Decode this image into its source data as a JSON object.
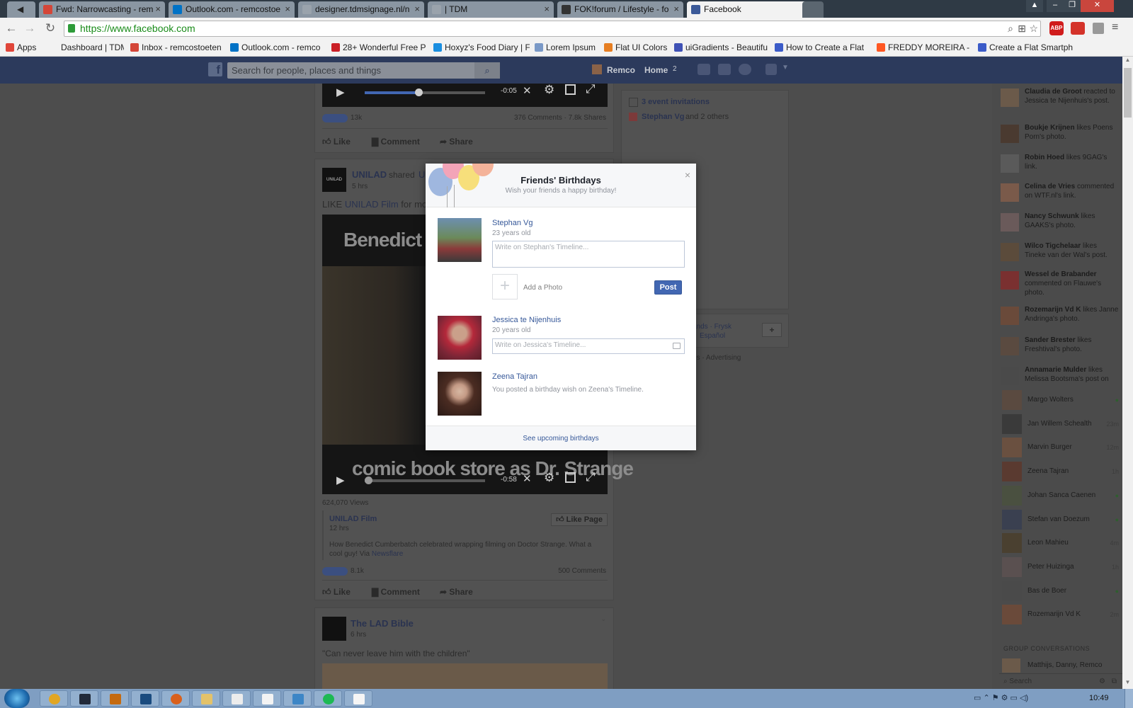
{
  "browser": {
    "tabs": [
      {
        "label": "Fwd: Narrowcasting - rem",
        "favicon_color": "#d44638",
        "icon": "gmail-icon"
      },
      {
        "label": "Outlook.com - remcostoe",
        "favicon_color": "#0072c6",
        "icon": "outlook-icon"
      },
      {
        "label": "designer.tdmsignage.nl/n",
        "favicon_color": "#9aa3ac",
        "icon": "page-icon"
      },
      {
        "label": "| TDM",
        "favicon_color": "#9aa3ac",
        "icon": "page-icon"
      },
      {
        "label": "FOK!forum / Lifestyle - fo",
        "favicon_color": "#333333",
        "icon": "fok-icon"
      },
      {
        "label": "Facebook",
        "favicon_color": "#3b5998",
        "icon": "facebook-icon"
      }
    ],
    "url": "https://www.facebook.com",
    "bookmarks": [
      {
        "label": "Apps",
        "color": "#e0463a"
      },
      {
        "label": "Dashboard | TDM",
        "color": "#f2f2f2"
      },
      {
        "label": "Inbox - remcostoeten",
        "color": "#d44638"
      },
      {
        "label": "Outlook.com - remco",
        "color": "#0072c6"
      },
      {
        "label": "28+ Wonderful Free P",
        "color": "#cb2027"
      },
      {
        "label": "Hoxyz's Food Diary | F",
        "color": "#1a8ee0"
      },
      {
        "label": "Lorem Ipsum",
        "color": "#7a99c7"
      },
      {
        "label": "Flat UI Colors",
        "color": "#e67e22"
      },
      {
        "label": "uiGradients - Beautifu",
        "color": "#3f51b5"
      },
      {
        "label": "How to Create a Flat",
        "color": "#3b5bc8"
      },
      {
        "label": "FREDDY MOREIRA - M",
        "color": "#ff5722"
      },
      {
        "label": "Create a Flat Smartph",
        "color": "#3b5bc8"
      }
    ],
    "ext_badge": "ABP"
  },
  "fb": {
    "search_placeholder": "Search for people, places and things",
    "user_name": "Remco",
    "home_label": "Home",
    "home_count": "2"
  },
  "feed": {
    "post1": {
      "time_left": "-0:05",
      "reactions": "13k",
      "comments_shares": "376 Comments · 7.8k Shares",
      "like": "Like",
      "comment": "Comment",
      "share": "Share"
    },
    "post2": {
      "page": "UNILAD",
      "shared": "shared",
      "shared_target": "UNI",
      "time": "5 hrs",
      "text_prefix": "LIKE",
      "text_link": "UNILAD Film",
      "text_suffix": "for more",
      "video_title_top": "Benedict Cu",
      "video_title_bottom": "comic book store as Dr. Strange",
      "video_time": "-0:58",
      "views": "624,070 Views",
      "source_name": "UNILAD Film",
      "source_time": "12 hrs",
      "like_page": "Like Page",
      "description": "How Benedict Cumberbatch celebrated wrapping filming on Doctor Strange. What a cool guy! Via",
      "description_link": "Newsflare",
      "reactions": "8.1k",
      "comments": "500 Comments",
      "like": "Like",
      "comment": "Comment",
      "share": "Share"
    },
    "post3": {
      "page": "The LAD Bible",
      "time": "6 hrs",
      "text": "\"Can never leave him with the children\""
    }
  },
  "right_col": {
    "invites": "3 event invitations",
    "birthday_name": "Stephan Vg",
    "birthday_rest": "and 2 others",
    "lang_1": "ands · Frysk",
    "lang_2": "Español",
    "footer": "es · Advertising"
  },
  "modal": {
    "title": "Friends' Birthdays",
    "subtitle": "Wish your friends a happy birthday!",
    "close": "×",
    "people": [
      {
        "name": "Stephan Vg",
        "age": "23 years old",
        "placeholder": "Write on Stephan's Timeline..."
      },
      {
        "name": "Jessica te Nijenhuis",
        "age": "20 years old",
        "placeholder": "Write on Jessica's Timeline..."
      },
      {
        "name": "Zeena Tajran",
        "status": "You posted a birthday wish on Zeena's Timeline."
      }
    ],
    "add_photo": "Add a Photo",
    "post": "Post",
    "footer": "See upcoming birthdays"
  },
  "ticker": [
    {
      "name": "Claudia de Groot",
      "text": "reacted to Jessica te Nijenhuis's post."
    },
    {
      "name": "Boukje Krijnen",
      "text": "likes Poens Porn's photo."
    },
    {
      "name": "Robin Hoed",
      "text": "likes 9GAG's link."
    },
    {
      "name": "Celina de Vries",
      "text": "commented on WTF.nl's link."
    },
    {
      "name": "Nancy Schwunk",
      "text": "likes GAAKS's photo."
    },
    {
      "name": "Wilco Tigchelaar",
      "text": "likes Tineke van der Wal's post."
    },
    {
      "name": "Wessel de Brabander",
      "text": "commented on Flauwe's photo."
    },
    {
      "name": "Rozemarijn Vd K",
      "text": "likes Janne Andringa's photo."
    },
    {
      "name": "Sander Brester",
      "text": "likes Freshtival's photo."
    },
    {
      "name": "Annamarie Mulder",
      "text": "likes Melissa Bootsma's post on"
    }
  ],
  "chat_contacts": [
    {
      "name": "Margo Wolters",
      "status": "●"
    },
    {
      "name": "Jan Willem Schealth",
      "status": "23m"
    },
    {
      "name": "Marvin Burger",
      "status": "12m"
    },
    {
      "name": "Zeena Tajran",
      "status": "1h"
    },
    {
      "name": "Johan Sanca Caenen",
      "status": "●"
    },
    {
      "name": "Stefan van Doezum",
      "status": "●"
    },
    {
      "name": "Leon Mahieu",
      "status": "4m"
    },
    {
      "name": "Peter Huizinga",
      "status": "1h"
    },
    {
      "name": "Bas de Boer",
      "status": "●"
    },
    {
      "name": "Rozemarijn Vd K",
      "status": "2m"
    }
  ],
  "chat": {
    "group_header": "GROUP CONVERSATIONS",
    "group_name": "Matthijs, Danny, Remco",
    "search_placeholder": "Search"
  },
  "taskbar": {
    "time": "10:49",
    "apps": [
      {
        "name": "chrome",
        "color": "#e1a624"
      },
      {
        "name": "batman",
        "color": "#222a3a"
      },
      {
        "name": "illustrator",
        "color": "#c46a10"
      },
      {
        "name": "photoshop",
        "color": "#1a4b7f"
      },
      {
        "name": "firefox",
        "color": "#d9601c"
      },
      {
        "name": "explorer",
        "color": "#e3c26a"
      },
      {
        "name": "calculator",
        "color": "#ececec"
      },
      {
        "name": "paint",
        "color": "#f3f3f3"
      },
      {
        "name": "notepad-l",
        "color": "#3d86c6"
      },
      {
        "name": "spotify",
        "color": "#1db954"
      },
      {
        "name": "blank",
        "color": "#f5f5f5"
      }
    ]
  }
}
